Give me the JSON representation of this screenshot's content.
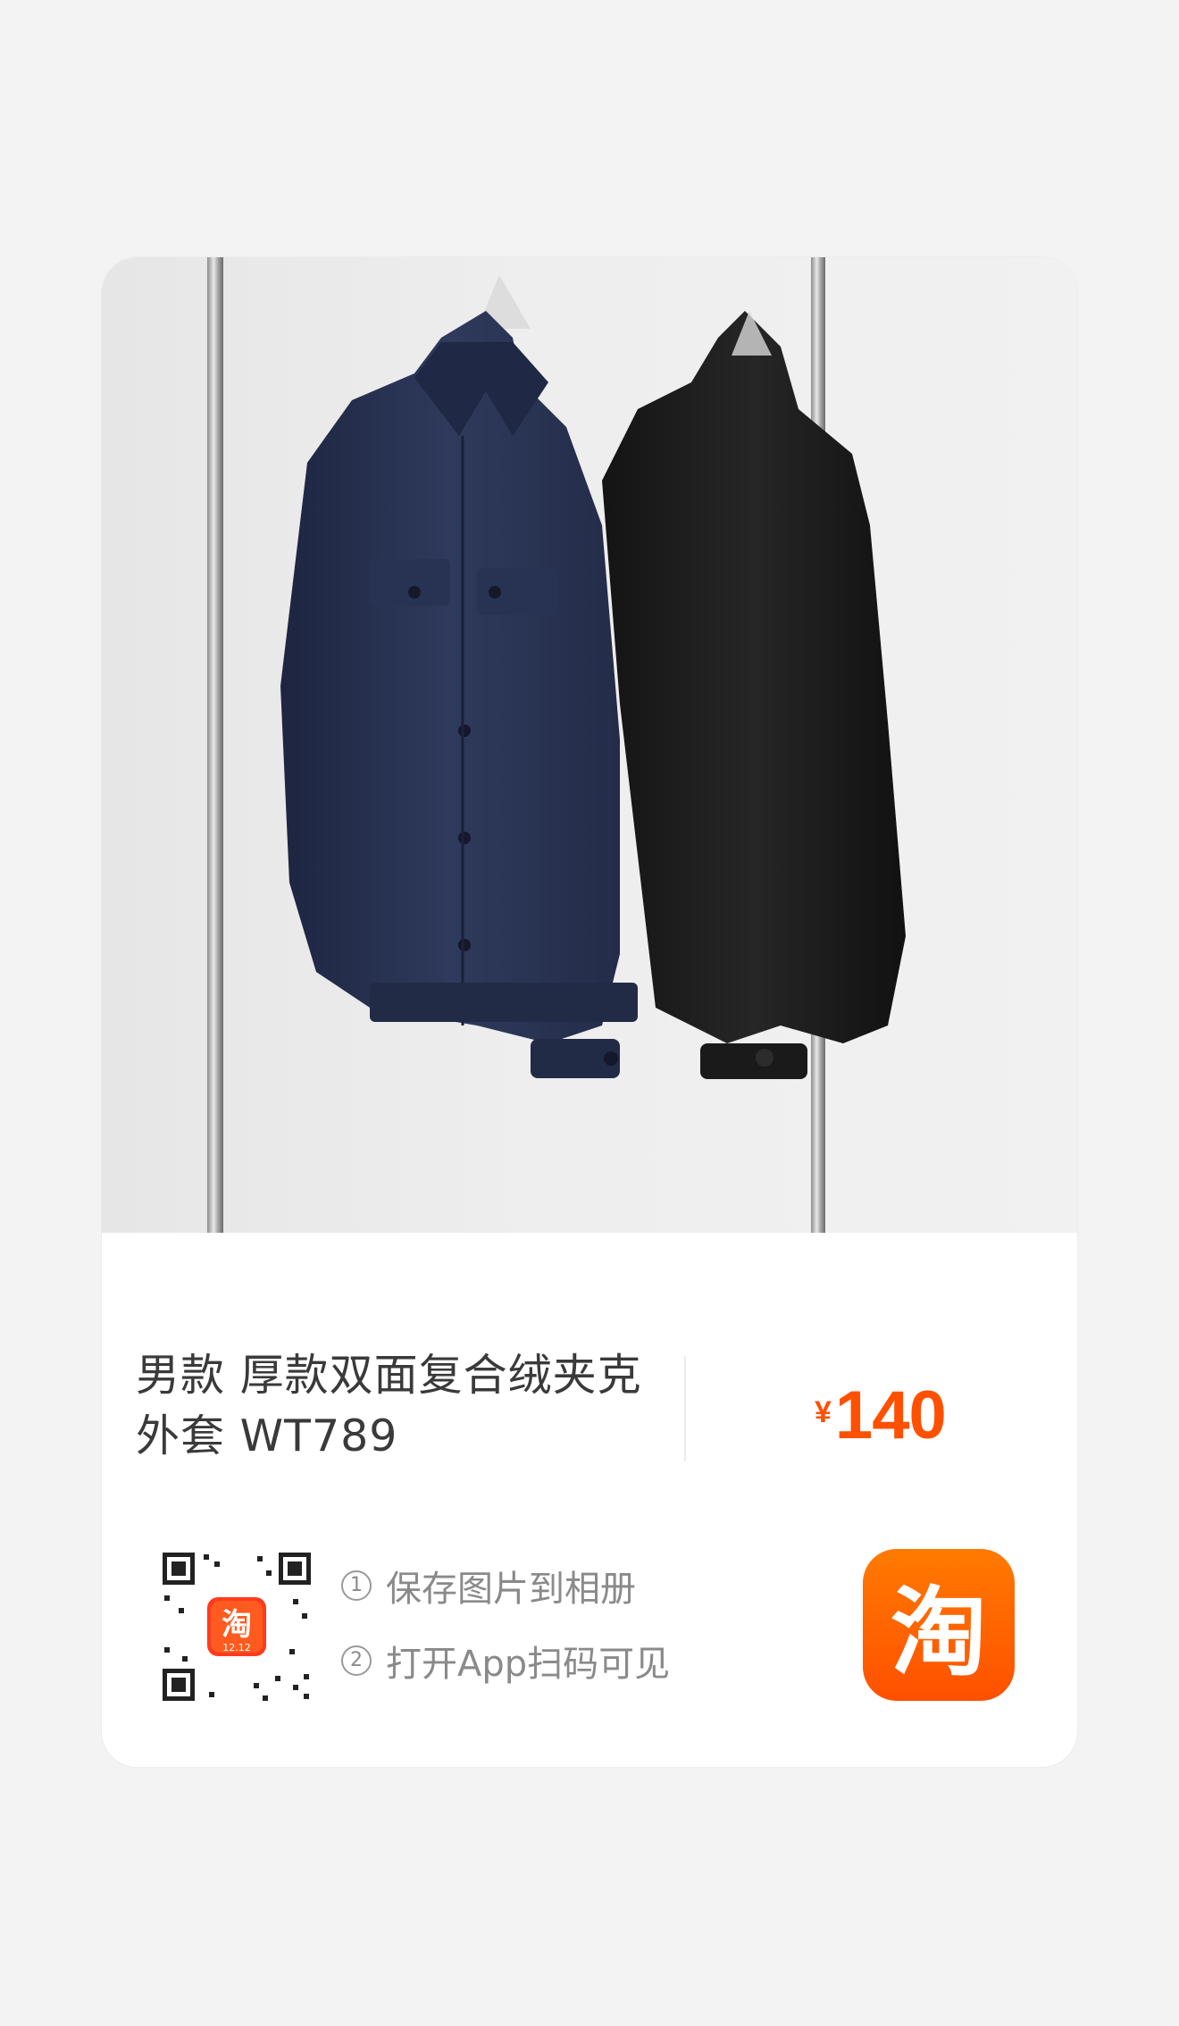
{
  "product": {
    "title_line1": "男款 厚款双面复合绒夹克",
    "title_line2": "外套 WT789",
    "price_currency": "¥",
    "price_amount": "140"
  },
  "qr": {
    "badge_text": "淘",
    "badge_sub": "12.12"
  },
  "instructions": [
    {
      "num": "1",
      "text": "保存图片到相册"
    },
    {
      "num": "2",
      "text": "打开App扫码可见"
    }
  ],
  "app_icon": {
    "glyph": "淘",
    "icon_name": "taobao-icon"
  },
  "colors": {
    "accent": "#ff5000",
    "navy_jacket": "#2b3550",
    "black_jacket": "#1c1c1c"
  }
}
